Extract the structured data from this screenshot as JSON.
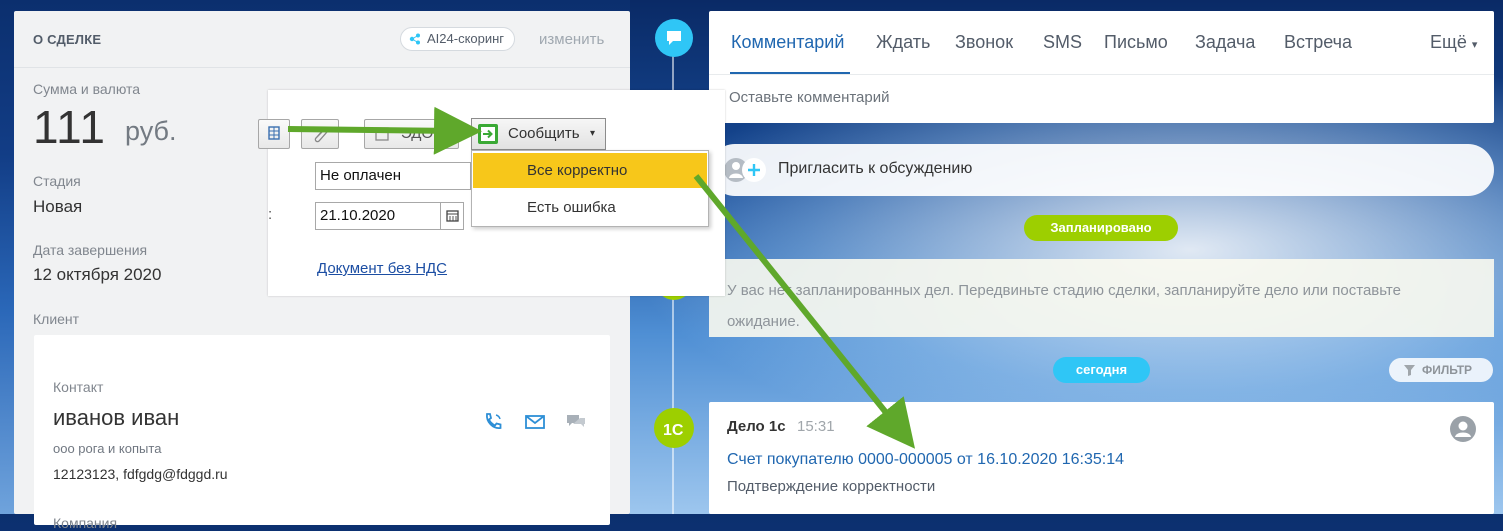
{
  "deal_panel": {
    "title": "О СДЕЛКЕ",
    "scoring_chip": "AI24-скоринг",
    "change_link": "изменить",
    "amount_label": "Сумма и валюта",
    "amount_value": "111",
    "currency": "руб.",
    "stage_label": "Стадия",
    "stage_value": "Новая",
    "close_date_label": "Дата завершения",
    "close_date_value": "12 октября 2020",
    "client_label": "Клиент",
    "client": {
      "contact_label": "Контакт",
      "contact_name": "иванов иван",
      "organization": "ооо рога и копыта",
      "contact_info": "12123123, fdfgdg@fdggd.ru",
      "company_label": "Компания"
    }
  },
  "popup": {
    "report_button": "Сообщить",
    "edo_label": "ЭДО",
    "payment_status": "Не оплачен",
    "date_field": "21.10.2020",
    "doc_link": "Документ без НДС",
    "menu_items": [
      "Все корректно",
      "Есть ошибка"
    ]
  },
  "activity": {
    "tabs": [
      "Комментарий",
      "Ждать",
      "Звонок",
      "SMS",
      "Письмо",
      "Задача",
      "Встреча"
    ],
    "more_tab": "Ещё",
    "comment_placeholder": "Оставьте комментарий",
    "invite_text": "Пригласить к обсуждению",
    "planned_pill": "Запланировано",
    "planned_empty": "У вас нет запланированных дел. Передвиньте стадию сделки, запланируйте дело или поставьте ожидание.",
    "today_pill": "сегодня",
    "filter_label": "ФИЛЬТР",
    "item": {
      "title": "Дело 1с",
      "time": "15:31",
      "link": "Счет покупателю 0000-000005 от 16.10.2020 16:35:14",
      "subtitle": "Подтверждение корректности"
    }
  },
  "colors": {
    "accent_blue": "#2067b0",
    "planned_green": "#9dcf00",
    "today_cyan": "#2fc6f6",
    "menu_highlight": "#f7c71a",
    "arrow_green": "#5fa82b"
  }
}
